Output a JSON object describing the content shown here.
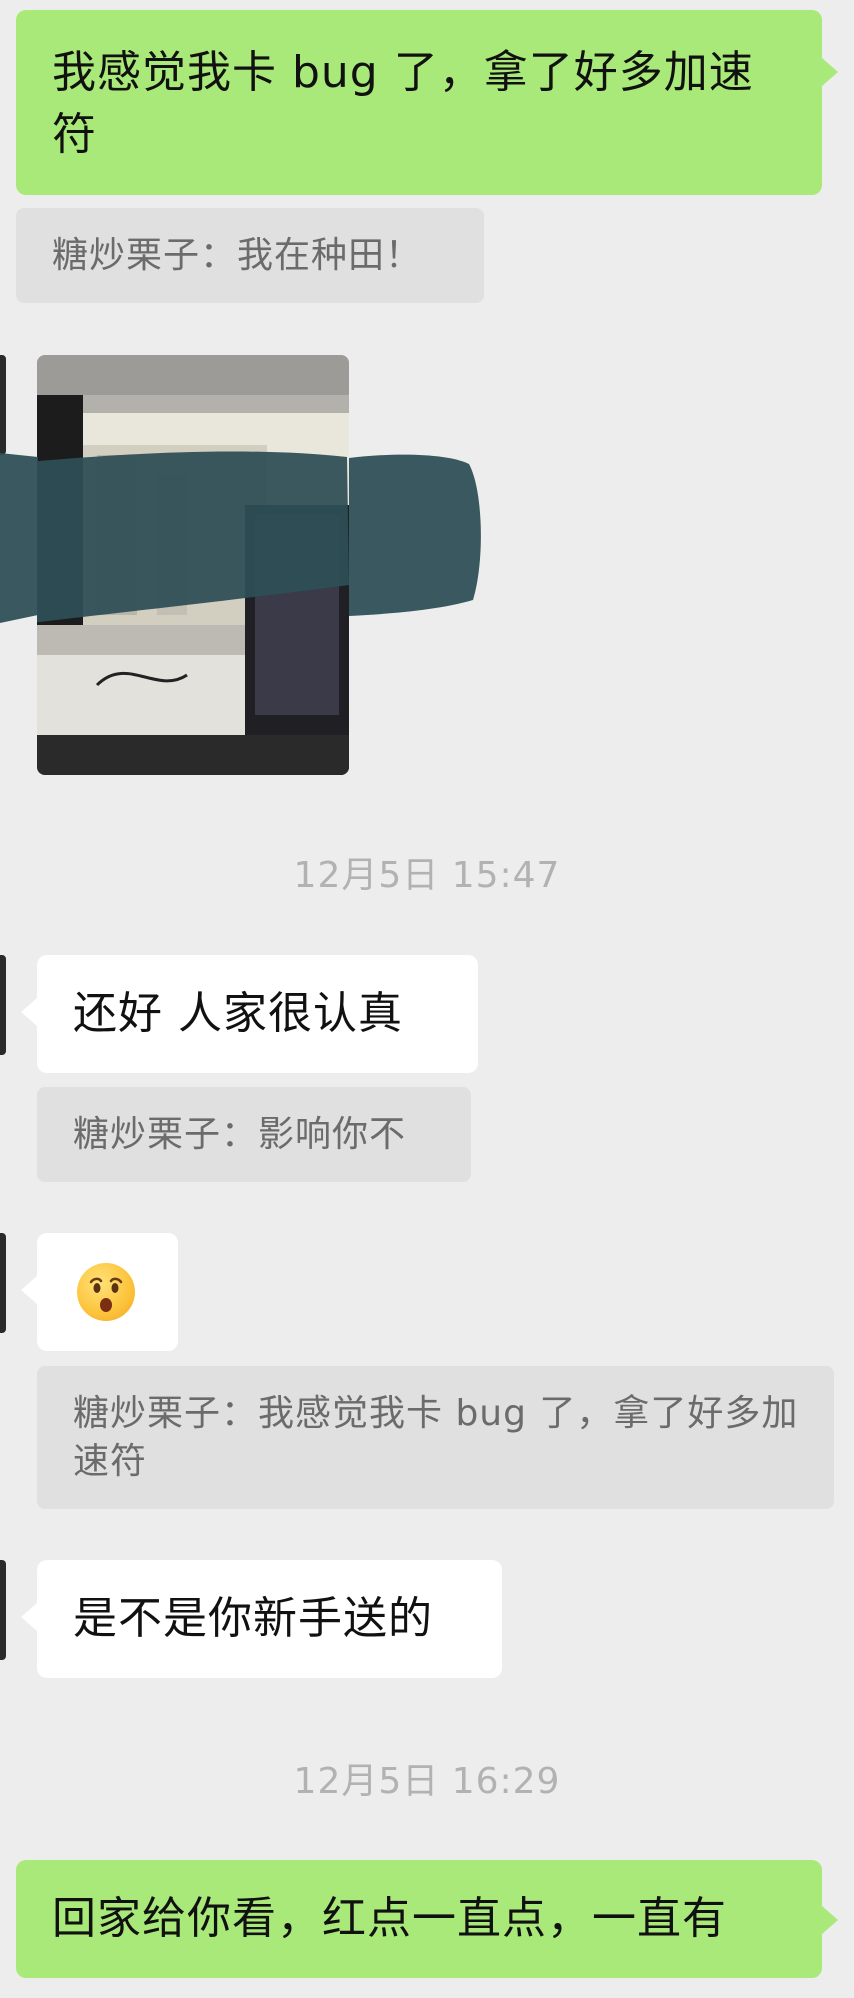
{
  "messages": [
    {
      "type": "sent",
      "text": "我感觉我卡 bug 了，拿了好多加速符"
    },
    {
      "type": "quote",
      "text": "糖炒栗子：我在种田！"
    },
    {
      "type": "photo"
    },
    {
      "type": "timestamp",
      "text": "12月5日 15:47"
    },
    {
      "type": "received",
      "text": "还好  人家很认真"
    },
    {
      "type": "quote",
      "text": "糖炒栗子：影响你不"
    },
    {
      "type": "received",
      "emoji": "hushed-face"
    },
    {
      "type": "quote",
      "text": "糖炒栗子：我感觉我卡 bug 了，拿了好多加速符"
    },
    {
      "type": "received",
      "text": "是不是你新手送的"
    },
    {
      "type": "timestamp",
      "text": "12月5日 16:29"
    },
    {
      "type": "sent",
      "text": "回家给你看，红点一直点，一直有"
    }
  ],
  "colors": {
    "background": "#ededed",
    "sent_bubble": "#a9e979",
    "received_bubble": "#ffffff",
    "quote_bubble": "#e0e0e0",
    "quote_text": "#6b6b6b",
    "timestamp_text": "#b2b2b2",
    "redaction": "#2f4f56"
  }
}
